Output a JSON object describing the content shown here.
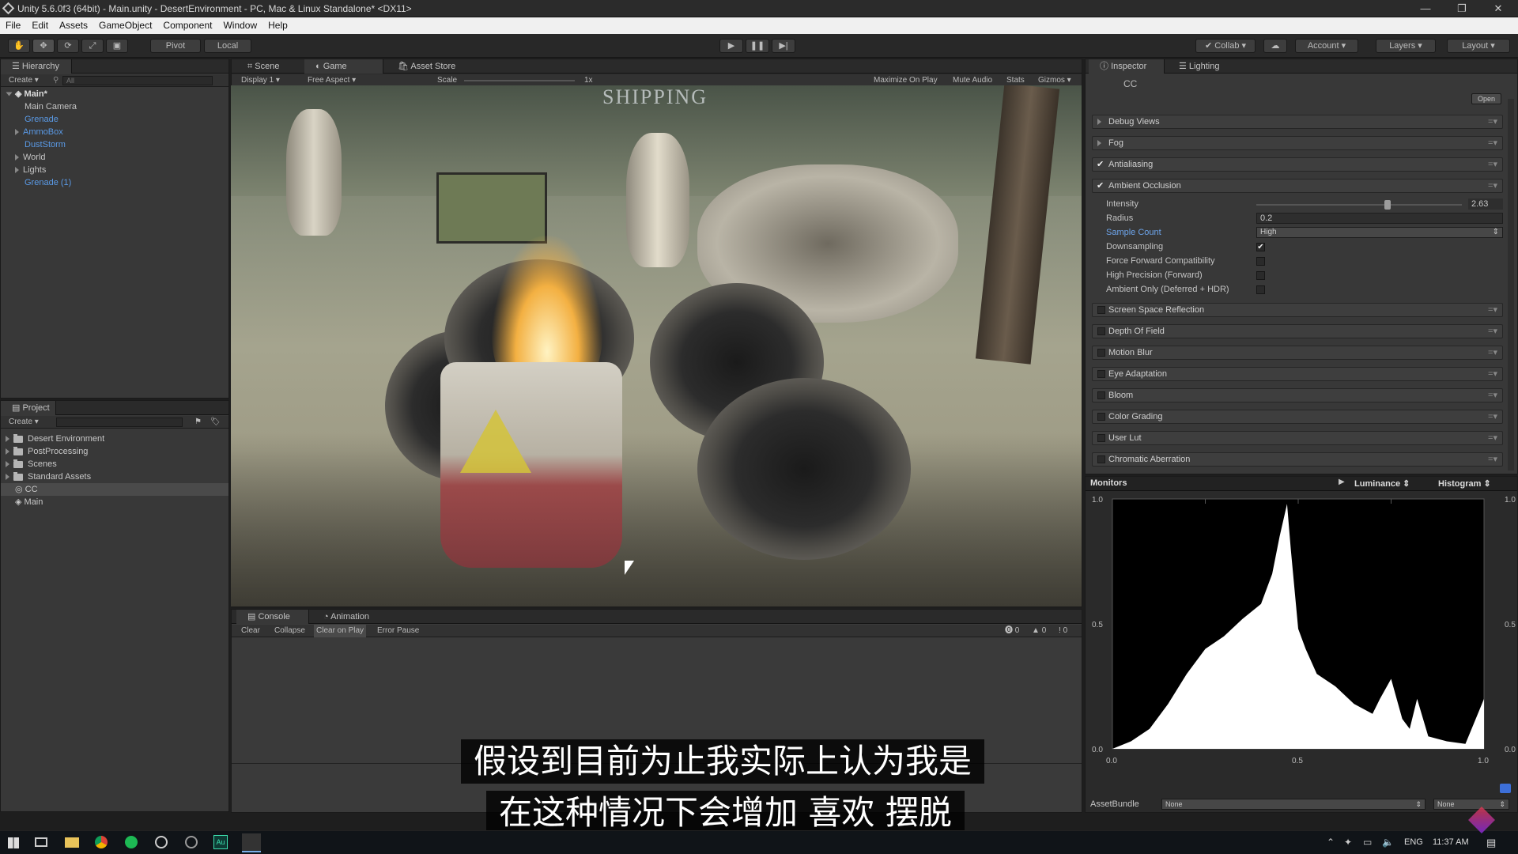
{
  "window": {
    "title": "Unity 5.6.0f3 (64bit) - Main.unity - DesertEnvironment - PC, Mac & Linux Standalone* <DX11>",
    "minimize": "—",
    "maximize": "❐",
    "close": "✕"
  },
  "menu": [
    "File",
    "Edit",
    "Assets",
    "GameObject",
    "Component",
    "Window",
    "Help"
  ],
  "toolbar": {
    "pivot": "Pivot",
    "local": "Local",
    "collab": "Collab",
    "account": "Account",
    "layers": "Layers",
    "layout": "Layout"
  },
  "hierarchy": {
    "tab": "Hierarchy",
    "create": "Create",
    "search_placeholder": "All",
    "scene": "Main*",
    "items": [
      {
        "label": "Main Camera",
        "color": "#c4c4c4"
      },
      {
        "label": "Grenade",
        "color": "#5a9ae6"
      },
      {
        "label": "AmmoBox",
        "color": "#5a9ae6"
      },
      {
        "label": "DustStorm",
        "color": "#5a9ae6"
      },
      {
        "label": "World",
        "color": "#c4c4c4"
      },
      {
        "label": "Lights",
        "color": "#c4c4c4"
      },
      {
        "label": "Grenade (1)",
        "color": "#5a9ae6"
      }
    ]
  },
  "project": {
    "tab": "Project",
    "create": "Create",
    "items": [
      "Desert Environment",
      "PostProcessing",
      "Scenes",
      "Standard Assets",
      "CC",
      "Main"
    ]
  },
  "center_tabs": {
    "scene": "Scene",
    "game": "Game",
    "asset_store": "Asset Store"
  },
  "game_bar": {
    "display": "Display 1",
    "aspect": "Free Aspect",
    "scale": "Scale",
    "scale_value": "1x",
    "maximize": "Maximize On Play",
    "mute": "Mute Audio",
    "stats": "Stats",
    "gizmos": "Gizmos"
  },
  "console": {
    "tab": "Console",
    "animation_tab": "Animation",
    "clear": "Clear",
    "collapse": "Collapse",
    "clear_on_play": "Clear on Play",
    "error_pause": "Error Pause",
    "errors": "0",
    "warnings": "0",
    "messages": "0"
  },
  "inspector": {
    "tab": "Inspector",
    "lighting_tab": "Lighting",
    "object": "CC",
    "open": "Open",
    "components": [
      {
        "label": "Debug Views",
        "checked": null
      },
      {
        "label": "Fog",
        "checked": null
      },
      {
        "label": "Antialiasing",
        "checked": true
      },
      {
        "label": "Ambient Occlusion",
        "checked": true
      }
    ],
    "ao": {
      "intensity_label": "Intensity",
      "intensity": "2.63",
      "radius_label": "Radius",
      "radius": "0.2",
      "sample_count_label": "Sample Count",
      "sample_count": "High",
      "downsampling": "Downsampling",
      "force_forward": "Force Forward Compatibility",
      "high_precision": "High Precision (Forward)",
      "ambient_only": "Ambient Only (Deferred + HDR)"
    },
    "effects": [
      "Screen Space Reflection",
      "Depth Of Field",
      "Motion Blur",
      "Eye Adaptation",
      "Bloom",
      "Color Grading",
      "User Lut",
      "Chromatic Aberration"
    ]
  },
  "monitors": {
    "title": "Monitors",
    "mode": "Luminance",
    "type": "Histogram",
    "y_ticks": [
      "1.0",
      "0.5",
      "0.0"
    ],
    "x_ticks": [
      "0.0",
      "0.5",
      "1.0"
    ],
    "assetbundle_label": "AssetBundle",
    "assetbundle_value": "None",
    "assetbundle_variant": "None"
  },
  "chart_data": {
    "type": "area",
    "title": "Histogram",
    "x": [
      0.0,
      0.05,
      0.1,
      0.15,
      0.2,
      0.25,
      0.3,
      0.35,
      0.4,
      0.43,
      0.45,
      0.47,
      0.48,
      0.5,
      0.52,
      0.55,
      0.6,
      0.65,
      0.7,
      0.72,
      0.75,
      0.78,
      0.8,
      0.82,
      0.85,
      0.9,
      0.95,
      1.0
    ],
    "values": [
      0.0,
      0.03,
      0.08,
      0.18,
      0.3,
      0.4,
      0.45,
      0.52,
      0.58,
      0.7,
      0.85,
      0.98,
      0.8,
      0.48,
      0.4,
      0.3,
      0.25,
      0.18,
      0.14,
      0.2,
      0.28,
      0.12,
      0.08,
      0.2,
      0.05,
      0.03,
      0.02,
      0.2
    ],
    "xlim": [
      0,
      1
    ],
    "ylim": [
      0,
      1
    ]
  },
  "subtitles": [
    "假设到目前为止我实际上认为我是",
    "在这种情况下会增加 喜欢 摆脱"
  ],
  "scene_text": "SHIPPING",
  "taskbar": {
    "lang": "ENG",
    "time": "11:37 AM"
  }
}
